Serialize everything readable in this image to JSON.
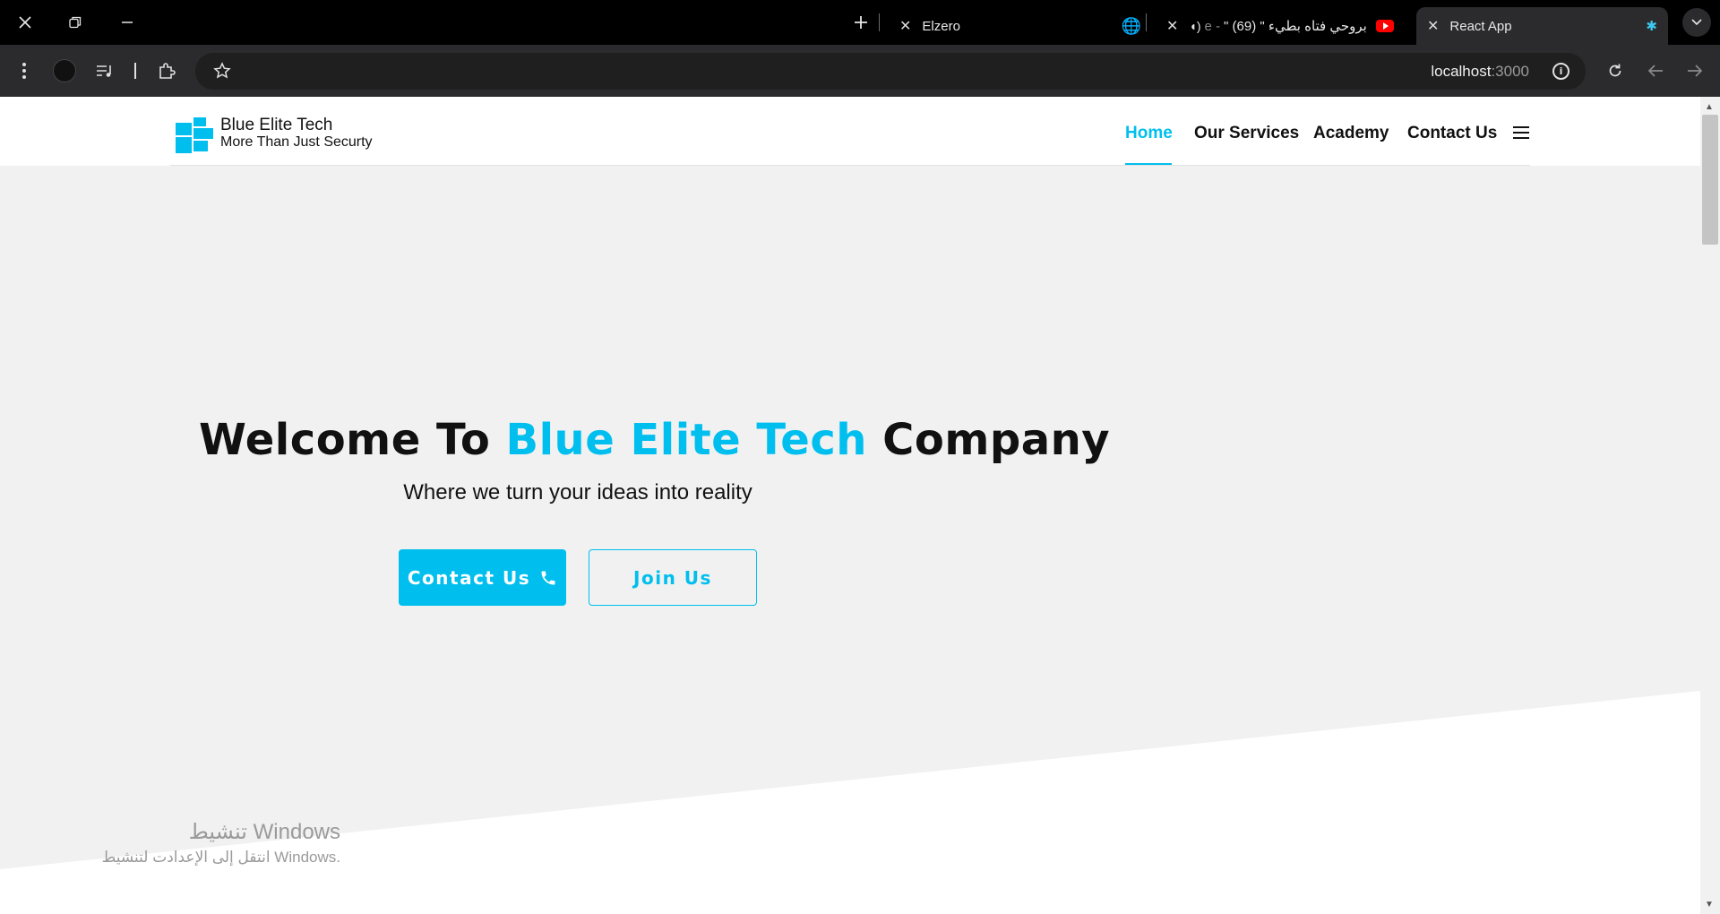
{
  "browser": {
    "tabs": [
      {
        "title": "Elzero"
      },
      {
        "title": "\" بروحي فتاه بطيء \" (69)",
        "prefix": "e -"
      },
      {
        "title": "React App"
      }
    ],
    "url_host": "localhost",
    "url_port": ":3000"
  },
  "site": {
    "brand_name": "Blue Elite Tech",
    "brand_tagline": "More Than Just Securty",
    "accent_color": "#00bfee",
    "nav": [
      {
        "label": "Home",
        "active": true
      },
      {
        "label": "Our Services"
      },
      {
        "label": "Academy"
      },
      {
        "label": "Contact Us"
      }
    ]
  },
  "hero": {
    "title_prefix": "Welcome To ",
    "title_highlight": "Blue Elite Tech",
    "title_suffix": " Company",
    "subtitle": "Where we turn your ideas into reality",
    "primary_button": "Contact Us",
    "primary_icon": "phone-icon",
    "secondary_button": "Join Us"
  },
  "os_overlay": {
    "line1": "تنشيط Windows",
    "line2": "انتقل إلى الإعدادت لتنشيط Windows."
  }
}
